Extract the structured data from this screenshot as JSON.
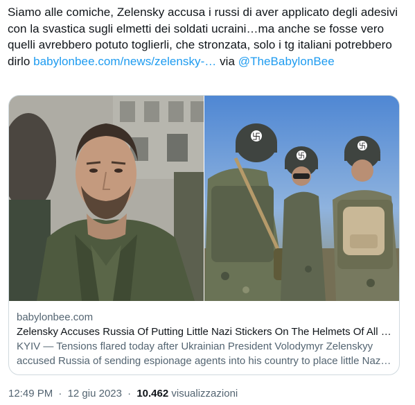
{
  "tweet": {
    "text": "Siamo alle comiche, Zelensky accusa i russi di aver applicato degli adesivi con la svastica sugli elmetti dei soldati ucraini…ma anche se fosse vero quelli avrebbero potuto toglierli, che stronzata, solo i tg italiani potrebbero dirlo",
    "link_text": "babylonbee.com/news/zelensky-…",
    "via_text": "via",
    "mention": "@TheBabylonBee"
  },
  "card": {
    "domain": "babylonbee.com",
    "title": "Zelensky Accuses Russia Of Putting Little Nazi Stickers On The Helmets Of All Ukrainian Soldiers",
    "description": "KYIV — Tensions flared today after Ukrainian President Volodymyr Zelenskyy accused Russia of sending espionage agents into his country to place little Nazi stickers on the helmets of all Ukrainian soldiers."
  },
  "meta": {
    "time": "12:49 PM",
    "date": "12 giu 2023",
    "separator": "·",
    "views_count": "10.462",
    "views_label": "visualizzazioni"
  },
  "colors": {
    "link": "#1d9bf0",
    "secondary_text": "#536471",
    "primary_text": "#0f1419",
    "card_border": "#cfd9de"
  }
}
